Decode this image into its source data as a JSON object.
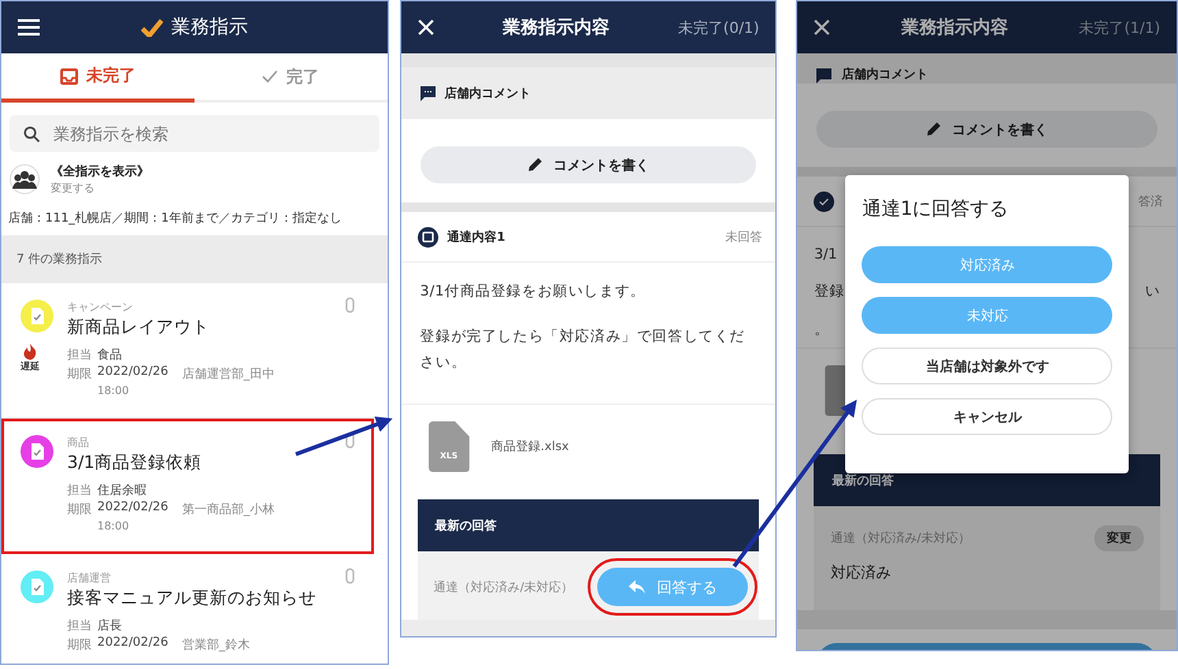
{
  "list_screen": {
    "header": {
      "title": "業務指示"
    },
    "tabs": [
      {
        "label": "未完了",
        "selected": true
      },
      {
        "label": "完了",
        "selected": false
      }
    ],
    "search": {
      "placeholder": "業務指示を検索"
    },
    "filter": {
      "title": "《全指示を表示》",
      "action": "変更する",
      "summary": "店舗：111_札幌店／期間：1年前まで／カテゴリ：指定なし"
    },
    "section": "7 件の業務指示",
    "tasks": [
      {
        "category": "キャンペーン",
        "title": "新商品レイアウト",
        "color": "#f4ef4a",
        "assignee_label": "担当",
        "assignee": "食品",
        "due_label": "期限",
        "due": "2022/02/26",
        "author": "店舗運営部_田中",
        "time": "18:00",
        "badge": "遅延",
        "highlighted": false
      },
      {
        "category": "商品",
        "title": "3/1商品登録依頼",
        "color": "#e63fe6",
        "assignee_label": "担当",
        "assignee": "住居余暇",
        "due_label": "期限",
        "due": "2022/02/26",
        "author": "第一商品部_小林",
        "time": "18:00",
        "highlighted": true
      },
      {
        "category": "店舗運営",
        "title": "接客マニュアル更新のお知らせ",
        "color": "#62eef4",
        "assignee_label": "担当",
        "assignee": "店長",
        "due_label": "期限",
        "due": "2022/02/26",
        "author": "営業部_鈴木",
        "highlighted": false
      }
    ]
  },
  "detail_screen": {
    "header": {
      "title": "業務指示内容",
      "status": "未完了(0/1)"
    },
    "comment_section": {
      "title": "店舗内コメント",
      "button": "コメントを書く"
    },
    "notice": {
      "title": "通達内容1",
      "status": "未回答",
      "answered": false,
      "paragraphs": [
        "3/1付商品登録をお願いします。",
        "登録が完了したら「対応済み」で回答してください。"
      ],
      "attachment": {
        "file_type": "XLS",
        "name": "商品登録.xlsx"
      }
    },
    "latest": {
      "title": "最新の回答",
      "label": "通達（対応済み/未対応）",
      "button": {
        "label": "回答する",
        "highlighted": true
      }
    }
  },
  "answer_screen": {
    "header": {
      "title": "業務指示内容",
      "status": "未完了(1/1)"
    },
    "comment_section": {
      "title": "店舗内コメント",
      "button": "コメントを書く"
    },
    "notice": {
      "status": "答済",
      "answered": true,
      "body_left": [
        "3/1",
        "登録",
        "。"
      ],
      "body_right": [
        "い"
      ]
    },
    "latest": {
      "title": "最新の回答",
      "label": "通達（対応済み/未対応）",
      "change_button": "変更",
      "value": "対応済み"
    },
    "dialog": {
      "title": "通達1に回答する",
      "options": [
        {
          "label": "対応済み",
          "kind": "primary"
        },
        {
          "label": "未対応",
          "kind": "primary"
        },
        {
          "label": "当店舗は対象外です",
          "kind": "outline"
        },
        {
          "label": "キャンセル",
          "kind": "outline"
        }
      ]
    }
  }
}
